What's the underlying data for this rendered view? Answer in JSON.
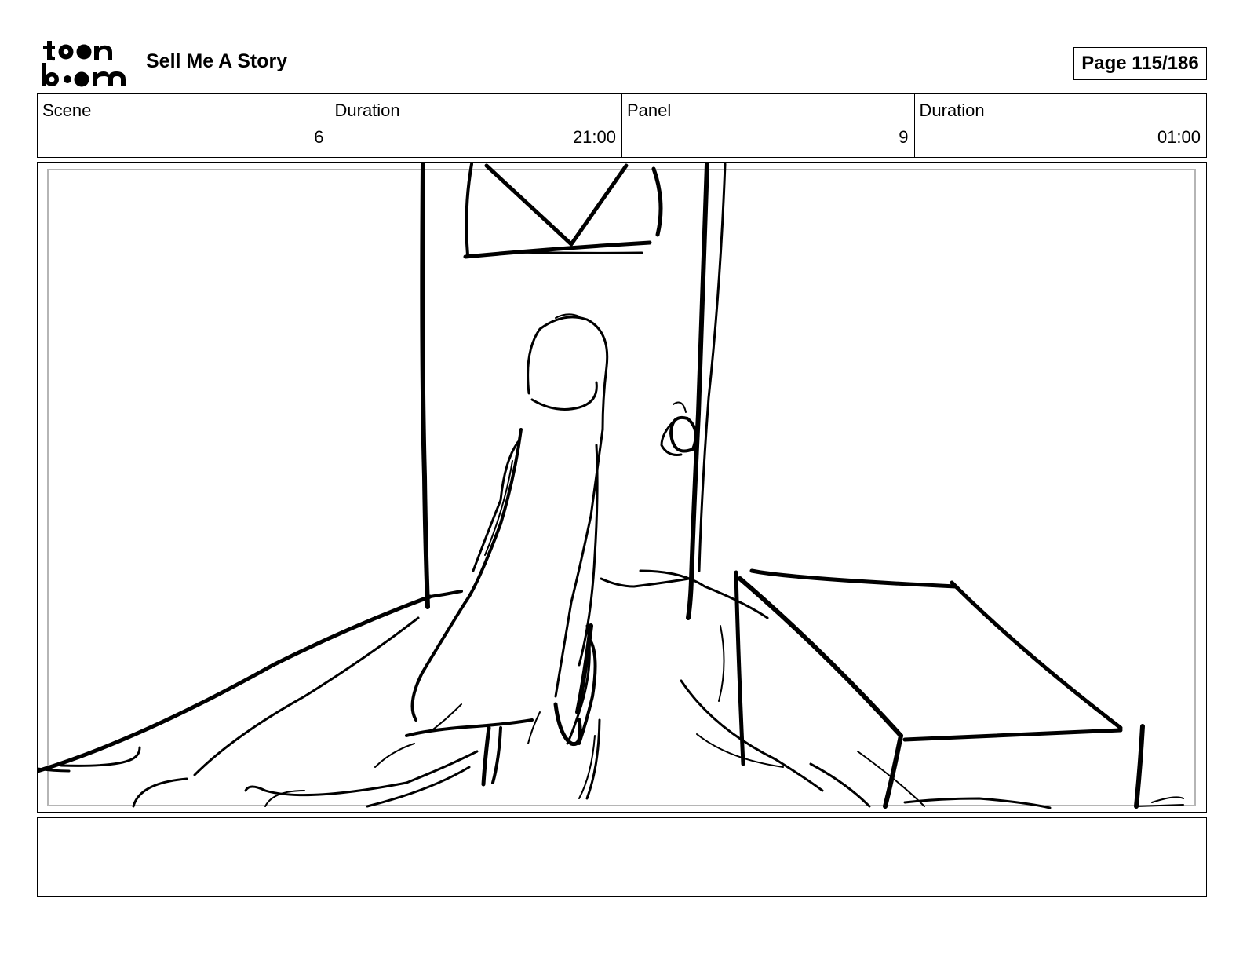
{
  "header": {
    "logo_text": "toon boom",
    "project_title": "Sell Me A Story",
    "page_label": "Page 115/186"
  },
  "info": {
    "scene_label": "Scene",
    "scene_value": "6",
    "scene_duration_label": "Duration",
    "scene_duration_value": "21:00",
    "panel_label": "Panel",
    "panel_value": "9",
    "panel_duration_label": "Duration",
    "panel_duration_value": "01:00"
  },
  "notes": {
    "text": ""
  }
}
